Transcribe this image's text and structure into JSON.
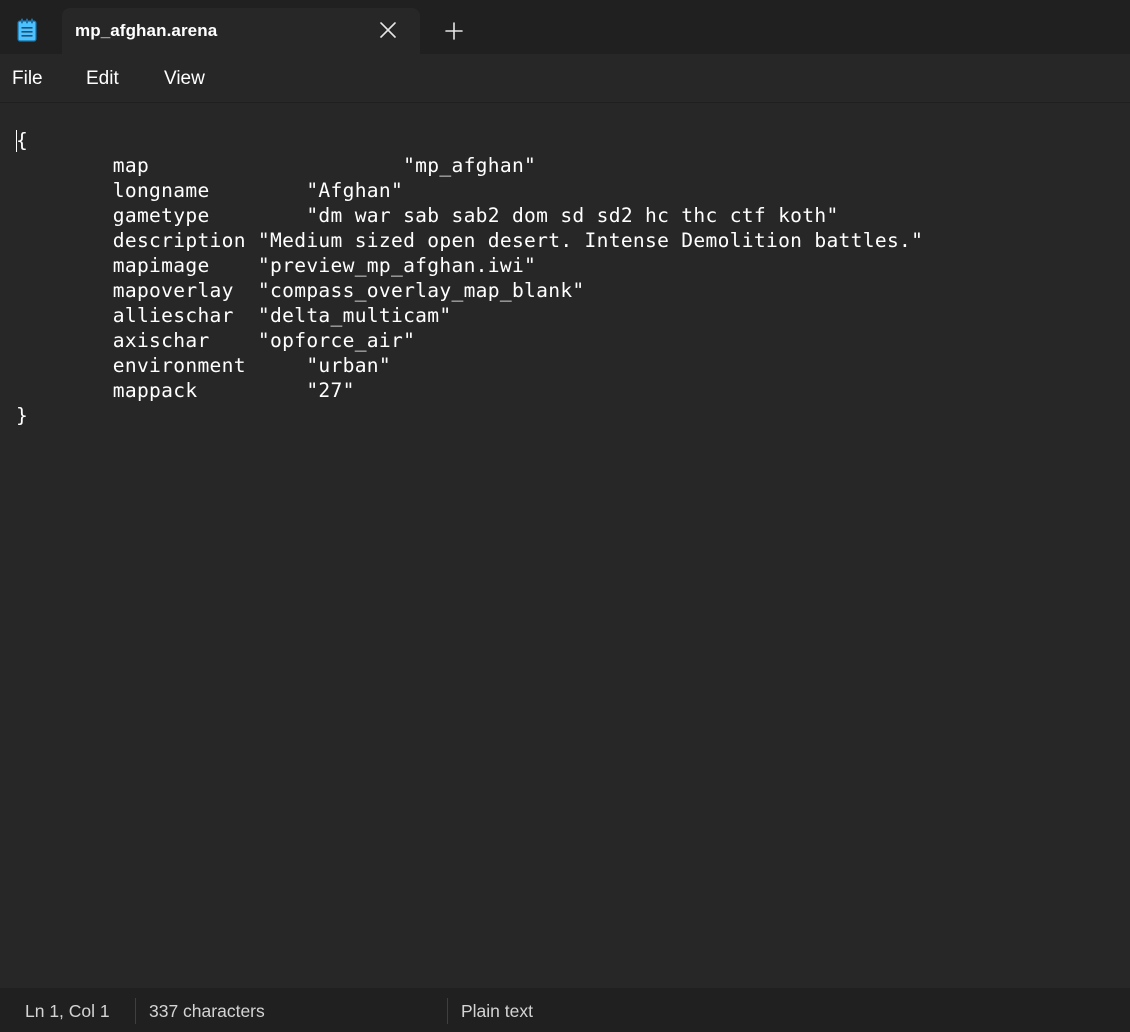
{
  "tab": {
    "title": "mp_afghan.arena",
    "app_icon": "notepad-icon",
    "close_icon": "close-icon",
    "new_tab_icon": "plus-icon"
  },
  "menu": {
    "items": [
      "File",
      "Edit",
      "View"
    ]
  },
  "editor": {
    "content": "{\n        map                     \"mp_afghan\"\n        longname        \"Afghan\"\n        gametype        \"dm war sab sab2 dom sd sd2 hc thc ctf koth\"\n        description \"Medium sized open desert. Intense Demolition battles.\"\n        mapimage    \"preview_mp_afghan.iwi\"\n        mapoverlay  \"compass_overlay_map_blank\"\n        allieschar  \"delta_multicam\"\n        axischar    \"opforce_air\"\n        environment     \"urban\"\n        mappack         \"27\"\n}"
  },
  "status": {
    "position": "Ln 1, Col 1",
    "characters": "337 characters",
    "format": "Plain text"
  },
  "colors": {
    "background": "#272727",
    "chrome": "#202020",
    "text": "#ffffff",
    "icon_accent": "#4cc2ff"
  }
}
